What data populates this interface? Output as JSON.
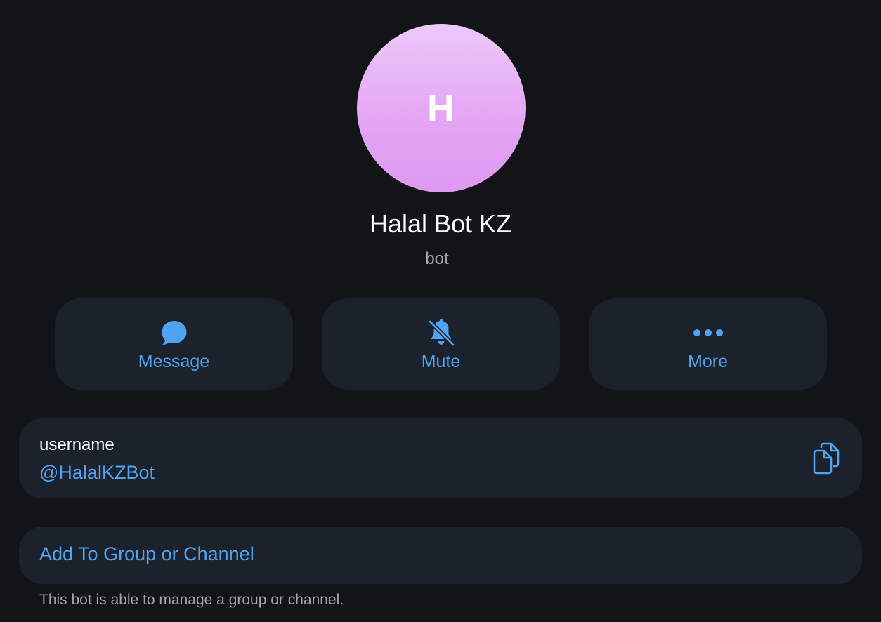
{
  "profile": {
    "avatar_letter": "H",
    "name": "Halal Bot KZ",
    "subtitle": "bot",
    "avatar_gradient": [
      "#ecc9fa",
      "#dd99f0"
    ]
  },
  "actions": [
    {
      "label": "Message",
      "icon": "chat-bubble-icon"
    },
    {
      "label": "Mute",
      "icon": "bell-off-icon"
    },
    {
      "label": "More",
      "icon": "more-dots-icon"
    }
  ],
  "info": {
    "username_label": "username",
    "username_value": "@HalalKZBot",
    "copy_icon": "copy-icon"
  },
  "add_to_group": {
    "label": "Add To Group or Channel",
    "note": "This bot is able to manage a group or channel."
  },
  "colors": {
    "background": "#131417",
    "card": "#1b222c",
    "accent": "#4fa3ef",
    "secondary_text": "#a0a4ab"
  }
}
